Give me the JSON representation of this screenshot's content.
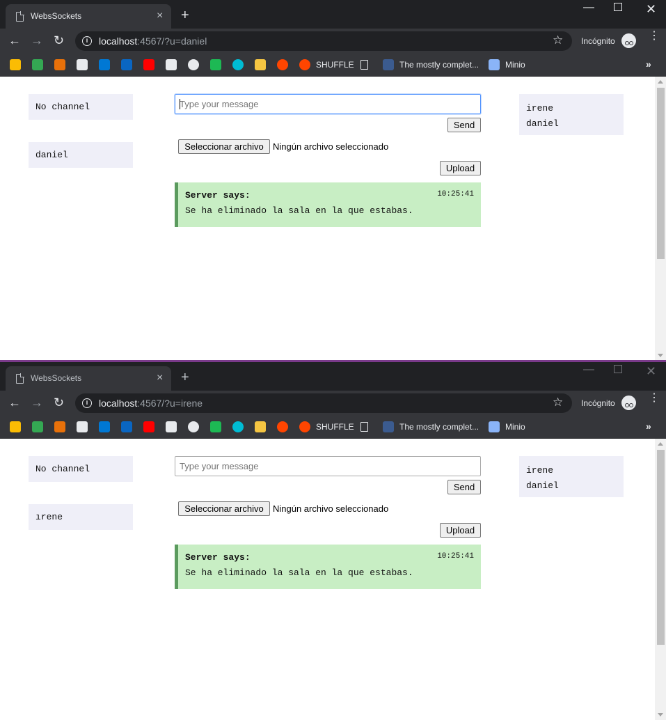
{
  "browser": {
    "tab_title": "WebsSockets",
    "tab_close": "×",
    "new_tab": "+",
    "incognito_label": "Incógnito",
    "bookmarks": [
      {
        "icon": "google-drive-icon",
        "label": "",
        "color": "#fbbc04"
      },
      {
        "icon": "leaf-icon",
        "label": "",
        "color": "#34a853"
      },
      {
        "icon": "in-icon",
        "label": "",
        "color": "#e8710a"
      },
      {
        "icon": "github-icon",
        "label": "",
        "color": "#e8eaed"
      },
      {
        "icon": "azure-devops-icon",
        "label": "",
        "color": "#0078d4"
      },
      {
        "icon": "linkedin-icon",
        "label": "",
        "color": "#0a66c2"
      },
      {
        "icon": "youtube-icon",
        "label": "",
        "color": "#ff0000"
      },
      {
        "icon": "ta-icon",
        "label": "",
        "color": "#e8eaed"
      },
      {
        "icon": "camera-icon",
        "label": "",
        "color": "#e8eaed"
      },
      {
        "icon": "network-icon",
        "label": "",
        "color": "#1db954"
      },
      {
        "icon": "circle-icon",
        "label": "",
        "color": "#00bcd4"
      },
      {
        "icon": "badge-icon",
        "label": "",
        "color": "#f5c542"
      },
      {
        "icon": "reddit-icon",
        "label": "",
        "color": "#ff4500"
      },
      {
        "icon": "reddit-icon",
        "label": "SHUFFLE",
        "color": "#ff4500"
      },
      {
        "icon": "page-icon",
        "label": "",
        "color": "#e8eaed"
      },
      {
        "icon": "article-icon",
        "label": "The mostly complet...",
        "color": "#3b5b8f"
      },
      {
        "icon": "monitor-icon",
        "label": "Minio",
        "color": "#8ab4f8"
      }
    ],
    "bookmarks_more": "»"
  },
  "windows": [
    {
      "url_host": "localhost",
      "url_rest": ":4567/?u=daniel",
      "channel_label": "No channel",
      "username": "daniel",
      "online_users": [
        "irene",
        "daniel"
      ]
    },
    {
      "url_host": "localhost",
      "url_rest": ":4567/?u=irene",
      "channel_label": "No channel",
      "username": "ırene",
      "online_users": [
        "irene",
        "daniel"
      ]
    }
  ],
  "chat": {
    "input_placeholder": "Type your message",
    "send_label": "Send",
    "file_button_label": "Seleccionar archivo",
    "file_status": "Ningún archivo seleccionado",
    "upload_label": "Upload"
  },
  "messages": [
    {
      "sender": "Server says:",
      "time": "10:25:41",
      "text": "Se ha eliminado la sala en la que estabas."
    }
  ],
  "colors": {
    "message_bg": "#c8eec4",
    "message_border": "#5b9b5e",
    "panel_bg": "#efeff8"
  }
}
